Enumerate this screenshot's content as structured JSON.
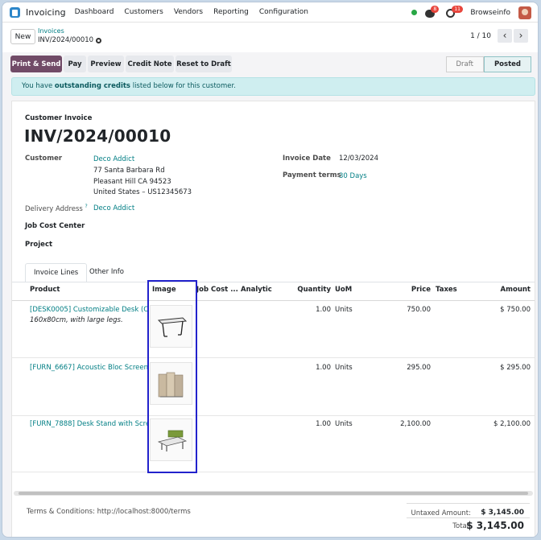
{
  "navbar": {
    "app_name": "Invoicing",
    "menu": [
      "Dashboard",
      "Customers",
      "Vendors",
      "Reporting",
      "Configuration"
    ],
    "chat_count": "8",
    "activity_count": "11",
    "company": "Browseinfo"
  },
  "control": {
    "new_label": "New",
    "breadcrumb_parent": "Invoices",
    "breadcrumb_current": "INV/2024/00010",
    "pager": "1 / 10",
    "prev": "‹",
    "next": "›"
  },
  "actions": {
    "print_send": "Print & Send",
    "pay": "Pay",
    "preview": "Preview",
    "credit_note": "Credit Note",
    "reset": "Reset to Draft",
    "status": [
      "Draft",
      "Posted"
    ]
  },
  "alert": {
    "prefix": "You have ",
    "strong": "outstanding credits",
    "suffix": " listed below for this customer."
  },
  "invoice": {
    "type": "Customer Invoice",
    "name": "INV/2024/00010",
    "customer_label": "Customer",
    "customer_name": "Deco Addict",
    "address_1": "77 Santa Barbara Rd",
    "address_2": "Pleasant Hill CA 94523",
    "address_3": "United States – US12345673",
    "delivery_label": "Delivery Address",
    "delivery_sup": "?",
    "delivery_value": "Deco Addict",
    "job_cost_label": "Job Cost Center",
    "project_label": "Project",
    "date_label": "Invoice Date",
    "date_value": "12/03/2024",
    "terms_label": "Payment terms",
    "terms_value": "30 Days"
  },
  "tabs": [
    "Invoice Lines",
    "Other Info"
  ],
  "table": {
    "headers": {
      "product": "Product",
      "image": "Image",
      "job_cost": "Job Cost ...",
      "analytic": "Analytic",
      "quantity": "Quantity",
      "uom": "UoM",
      "price": "Price",
      "taxes": "Taxes",
      "amount": "Amount"
    },
    "rows": [
      {
        "product": "[DESK0005] Customizable Desk (Cu...",
        "desc": "160x80cm, with large legs.",
        "quantity": "1.00",
        "uom": "Units",
        "price": "750.00",
        "amount": "$ 750.00"
      },
      {
        "product": "[FURN_6667] Acoustic Bloc Screens...",
        "desc": "",
        "quantity": "1.00",
        "uom": "Units",
        "price": "295.00",
        "amount": "$ 295.00"
      },
      {
        "product": "[FURN_7888] Desk Stand with Screen",
        "desc": "",
        "quantity": "1.00",
        "uom": "Units",
        "price": "2,100.00",
        "amount": "$ 2,100.00"
      }
    ]
  },
  "footer": {
    "terms": "Terms & Conditions: http://localhost:8000/terms",
    "untaxed_label": "Untaxed Amount:",
    "untaxed_value": "$ 3,145.00",
    "total_label": "Total:",
    "total_value": "$ 3,145.00"
  },
  "colors": {
    "primary": "#714b67",
    "link": "#017e84",
    "highlight": "#2222cc"
  }
}
